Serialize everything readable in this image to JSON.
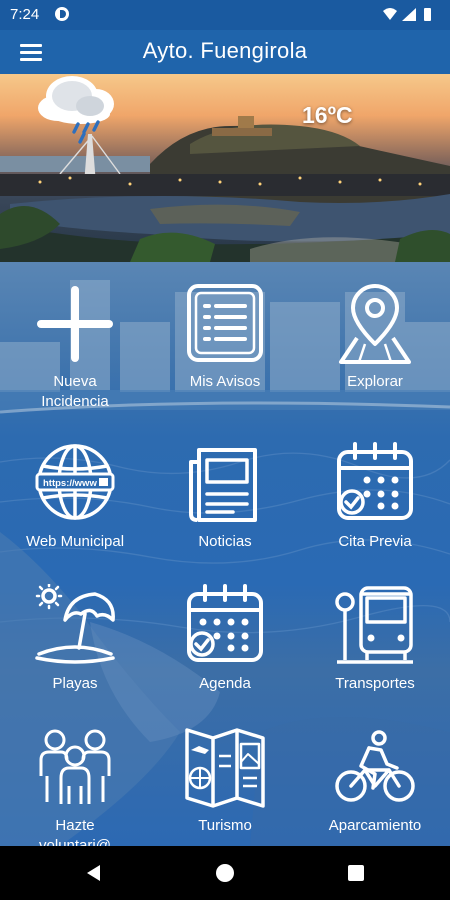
{
  "status_bar": {
    "time": "7:24",
    "icons": [
      "notification-icon",
      "wifi-icon",
      "signal-icon",
      "battery-icon"
    ]
  },
  "app_bar": {
    "title": "Ayto. Fuengirola",
    "menu_icon": "hamburger-menu-icon"
  },
  "weather": {
    "temperature": "16ºC",
    "icon": "rain-cloud-icon"
  },
  "tiles": [
    {
      "label": "Nueva\nIncidencia",
      "icon": "plus-icon"
    },
    {
      "label": "Mis Avisos",
      "icon": "list-icon"
    },
    {
      "label": "Explorar",
      "icon": "map-pin-icon"
    },
    {
      "label": "Web Municipal",
      "icon": "globe-icon"
    },
    {
      "label": "Noticias",
      "icon": "newspaper-icon"
    },
    {
      "label": "Cita Previa",
      "icon": "calendar-check-icon"
    },
    {
      "label": "Playas",
      "icon": "beach-umbrella-icon"
    },
    {
      "label": "Agenda",
      "icon": "agenda-calendar-icon"
    },
    {
      "label": "Transportes",
      "icon": "bus-stop-icon"
    },
    {
      "label": "Hazte\nvoluntari@",
      "icon": "volunteers-icon"
    },
    {
      "label": "Turismo",
      "icon": "tourism-brochure-icon"
    },
    {
      "label": "Aparcamiento",
      "icon": "bicycle-icon"
    }
  ],
  "nav_bar": {
    "back_icon": "back-triangle-icon",
    "home_icon": "home-circle-icon",
    "recents_icon": "recents-square-icon"
  },
  "colors": {
    "status_bar": "#1a5aa0",
    "app_bar": "#1f64ab",
    "tile_text": "#ffffff",
    "nav_bar": "#000000"
  }
}
